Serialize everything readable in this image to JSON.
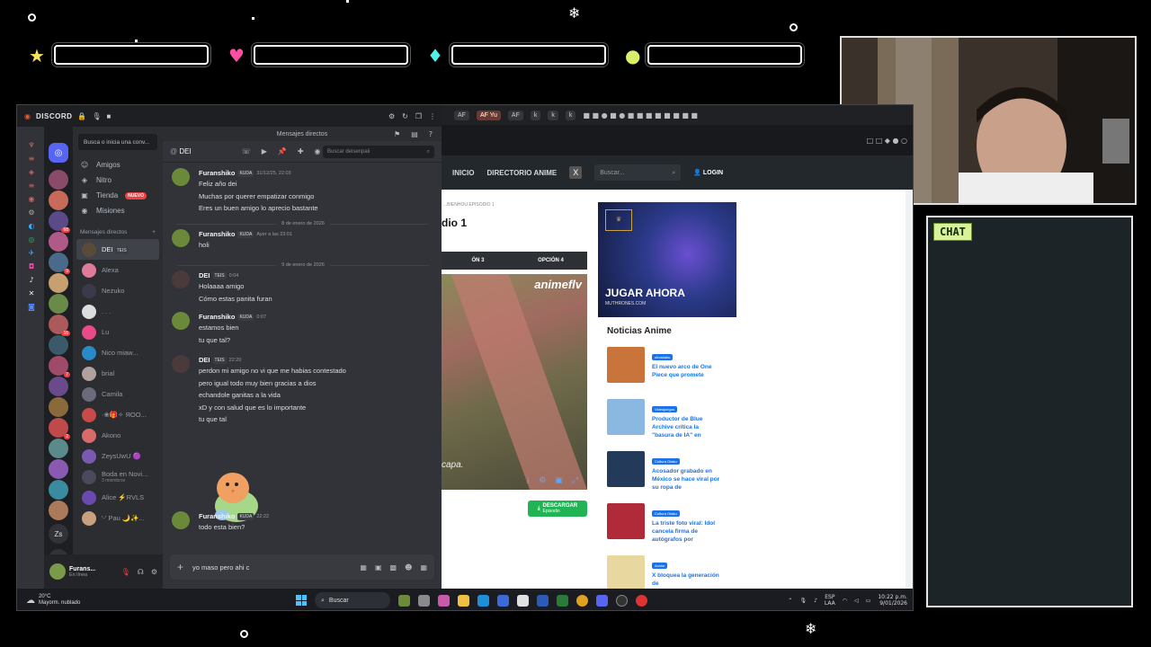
{
  "overlay": {
    "chat_label": "CHAT",
    "bar_icons": [
      "star-icon",
      "heart-icon",
      "diamond-icon",
      "coin-icon"
    ],
    "colors": {
      "star": "#f5e35a",
      "heart": "#ff4fa3",
      "diamond": "#4ff0e8",
      "coin": "#d7f06a"
    }
  },
  "discord": {
    "logo": "DISCORD",
    "top_center": "Mensajes directos",
    "dm_search_placeholder": "Busca o inicia una conv...",
    "nav": [
      {
        "label": "Amigos",
        "icon": "friends-icon"
      },
      {
        "label": "Nitro",
        "icon": "nitro-icon"
      },
      {
        "label": "Tienda",
        "icon": "shop-icon",
        "badge": "NUEVO"
      },
      {
        "label": "Misiones",
        "icon": "quests-icon"
      }
    ],
    "dm_header": "Mensajes directos",
    "dms": [
      {
        "name": "DEI",
        "tag": "TEIS",
        "active": true
      },
      {
        "name": "Alexa"
      },
      {
        "name": "Nezuko"
      },
      {
        "name": ". . ."
      },
      {
        "name": "Lu"
      },
      {
        "name": "Nico miaw..."
      },
      {
        "name": "brial"
      },
      {
        "name": "Camila"
      },
      {
        "name": "·❀🎁✧ ЯΟΟ..."
      },
      {
        "name": "Akono"
      },
      {
        "name": "ZeysUwU 🟣"
      },
      {
        "name": "Boda en Novi...",
        "sub": "3 miembros"
      },
      {
        "name": "Alice ⚡RVLS"
      },
      {
        "name": "'-' Pau 🌙✨..."
      }
    ],
    "server_badges": [
      "",
      "",
      "68",
      "",
      "9",
      "",
      "",
      "16",
      "",
      "7",
      "",
      "",
      "2",
      "",
      "",
      "",
      ""
    ],
    "user": {
      "name": "Furans...",
      "status": "En línea"
    },
    "channel": {
      "name": "DEI",
      "search_placeholder": "Buscar deisenpaii"
    },
    "messages": [
      {
        "author": "Furanshiko",
        "tag": "KUDA",
        "time": "31/12/25, 22:03",
        "lines": [
          "Feliz año dei",
          "Muchas por querer empatizar conmigo",
          "Eres un buen amigo lo aprecio bastante"
        ]
      },
      {
        "divider": "8 de enero de 2026"
      },
      {
        "author": "Furanshiko",
        "tag": "KUDA",
        "time": "Ayer a las 23:01",
        "lines": [
          "holi"
        ]
      },
      {
        "divider": "9 de enero de 2026"
      },
      {
        "author": "DEI",
        "tag": "TEIS",
        "time": "0:04",
        "lines": [
          "Holaaaa amigo",
          "Cómo estas panita furan"
        ]
      },
      {
        "author": "Furanshiko",
        "tag": "KUDA",
        "time": "0:07",
        "lines": [
          "estamos bien",
          "tu que tal?"
        ]
      },
      {
        "author": "DEI",
        "tag": "TEIS",
        "time": "22:20",
        "lines": [
          "perdon mi amigo no vi que me habias contestado",
          "pero igual todo muy bien gracias a dios",
          "echandole ganitas a la vida",
          "xD y con salud que es lo importante",
          "tu que tal"
        ]
      },
      {
        "author": "Furanshiko",
        "tag": "KUDA",
        "time": "22:22",
        "lines": [
          "todo esta bien?"
        ]
      }
    ],
    "composer_value": "yo maso pero ahi c"
  },
  "browser": {
    "tabs": [
      "AF",
      "AF Yu",
      "AF",
      "k",
      "k",
      "k"
    ],
    "nav": [
      "INICIO",
      "DIRECTORIO ANIME"
    ],
    "search_placeholder": "Buscar...",
    "login": "LOGIN",
    "breadcrumb": "...BIENHOU EPISODIO 1",
    "episode_title": "dio 1",
    "options": [
      "ÓN 3",
      "OPCIÓN 4"
    ],
    "player_logo": "animeflv",
    "player_sub": "capa.",
    "download": "DESCARGAR",
    "download_sub": "Episodio",
    "ad_cta": "JUGAR AHORA",
    "ad_url": "MUTHRONES.COM",
    "news_title": "Noticias Anime",
    "news": [
      {
        "tag": "otroskaku",
        "title": "El nuevo arco de One Piece que promete",
        "color": "#c8743a"
      },
      {
        "tag": "Videojuegos",
        "title": "Productor de Blue Archive crítica la \"basura de IA\" en",
        "color": "#8ab8e0"
      },
      {
        "tag": "Cultura Otaku",
        "title": "Acosador grabado en México se hace viral por su ropa de",
        "color": "#243a5a"
      },
      {
        "tag": "Cultura Otaku",
        "title": "La triste foto viral: Idol cancela firma de autógrafos por",
        "color": "#b02a3a"
      },
      {
        "tag": "Anime",
        "title": "X bloquea la generación de",
        "color": "#e8d8a0"
      }
    ]
  },
  "taskbar": {
    "temp": "20°C",
    "weather": "Mayorm. nublado",
    "search": "Buscar",
    "lang": "ESP",
    "lang_sub": "LAA",
    "time": "10:22 p.m.",
    "date": "9/01/2026"
  }
}
